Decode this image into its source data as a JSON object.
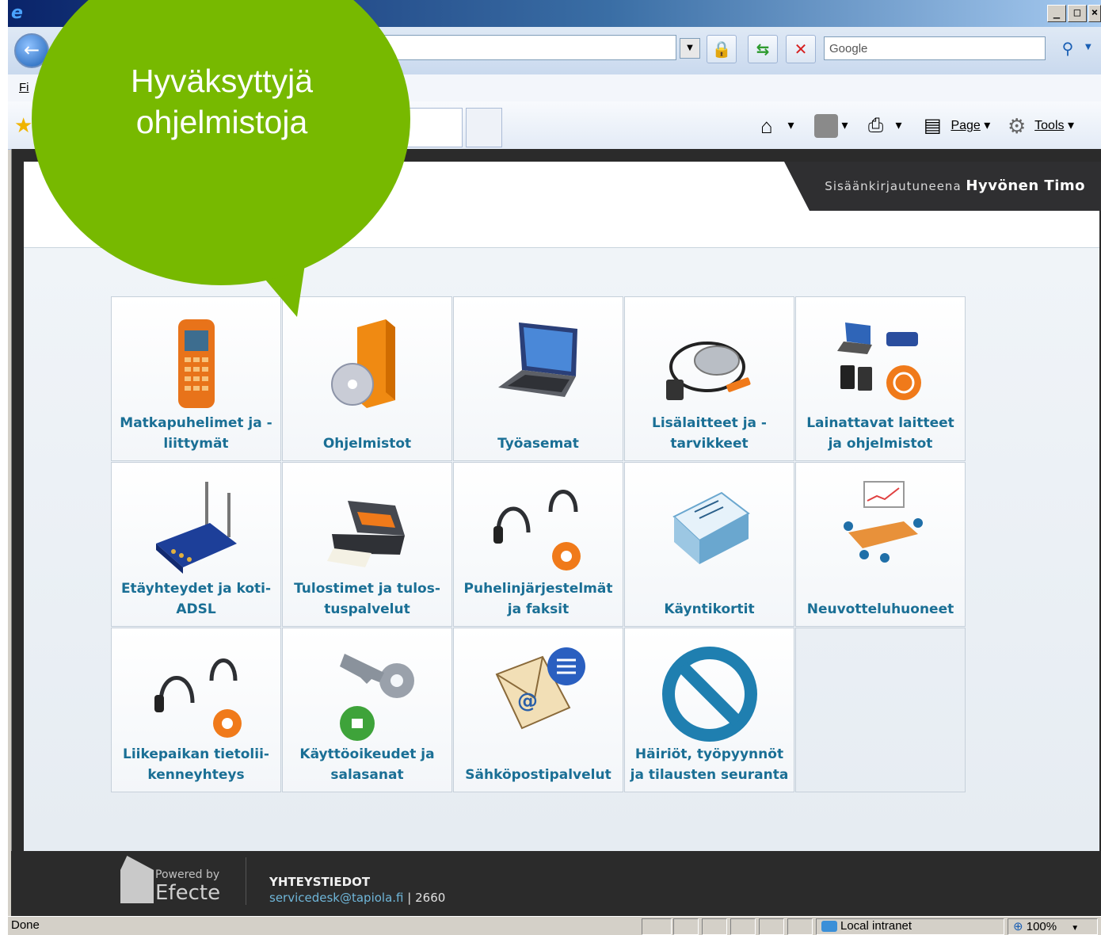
{
  "browser": {
    "search_placeholder": "Google",
    "menu_first_letters": "Fi",
    "commands": {
      "page": "Page",
      "tools": "Tools"
    }
  },
  "callout": {
    "line1": "Hyväksyttyjä",
    "line2": "ohjelmistoja"
  },
  "header": {
    "logged_in_prefix": "Sisäänkirjautuneena",
    "user_name": "Hyvönen Timo"
  },
  "tiles": [
    {
      "label": "Matkapuhelimet ja -liittymät",
      "icon": "mobile-phone-icon"
    },
    {
      "label": "Ohjelmistot",
      "icon": "software-box-icon"
    },
    {
      "label": "Työasemat",
      "icon": "laptop-icon"
    },
    {
      "label": "Lisälaitteet ja -tarvikkeet",
      "icon": "mouse-cable-icon"
    },
    {
      "label": "Lainattavat laitteet ja ohjelmistot",
      "icon": "loan-devices-icon"
    },
    {
      "label": "Etäyhteydet ja koti-ADSL",
      "icon": "router-icon"
    },
    {
      "label": "Tulostimet ja tulos-tuspalvelut",
      "icon": "printer-icon"
    },
    {
      "label": "Puhelinjärjestelmät ja faksit",
      "icon": "headset-gear-icon"
    },
    {
      "label": "Käyntikortit",
      "icon": "business-cards-icon"
    },
    {
      "label": "Neuvotteluhuoneet",
      "icon": "meeting-room-icon"
    },
    {
      "label": "Liikepaikan tietolii-kenneyhteys",
      "icon": "headset-network-icon"
    },
    {
      "label": "Käyttöoikeudet ja salasanat",
      "icon": "key-lock-icon"
    },
    {
      "label": "Sähköpostipalvelut",
      "icon": "email-icon"
    },
    {
      "label": "Häiriöt, työpyynnöt ja tilausten seuranta",
      "icon": "no-entry-icon"
    }
  ],
  "footer": {
    "powered_by": "Powered by",
    "brand": "Efecte",
    "contact_title": "YHTEYSTIEDOT",
    "email": "servicedesk@tapiola.fi",
    "separator": "|",
    "phone": "2660"
  },
  "status": {
    "left_text": "Done",
    "zone": "Local intranet",
    "zoom": "100%"
  },
  "colors": {
    "callout": "#77b900",
    "tile_label": "#1a6f95",
    "footer_bg": "#2b2b2b"
  }
}
